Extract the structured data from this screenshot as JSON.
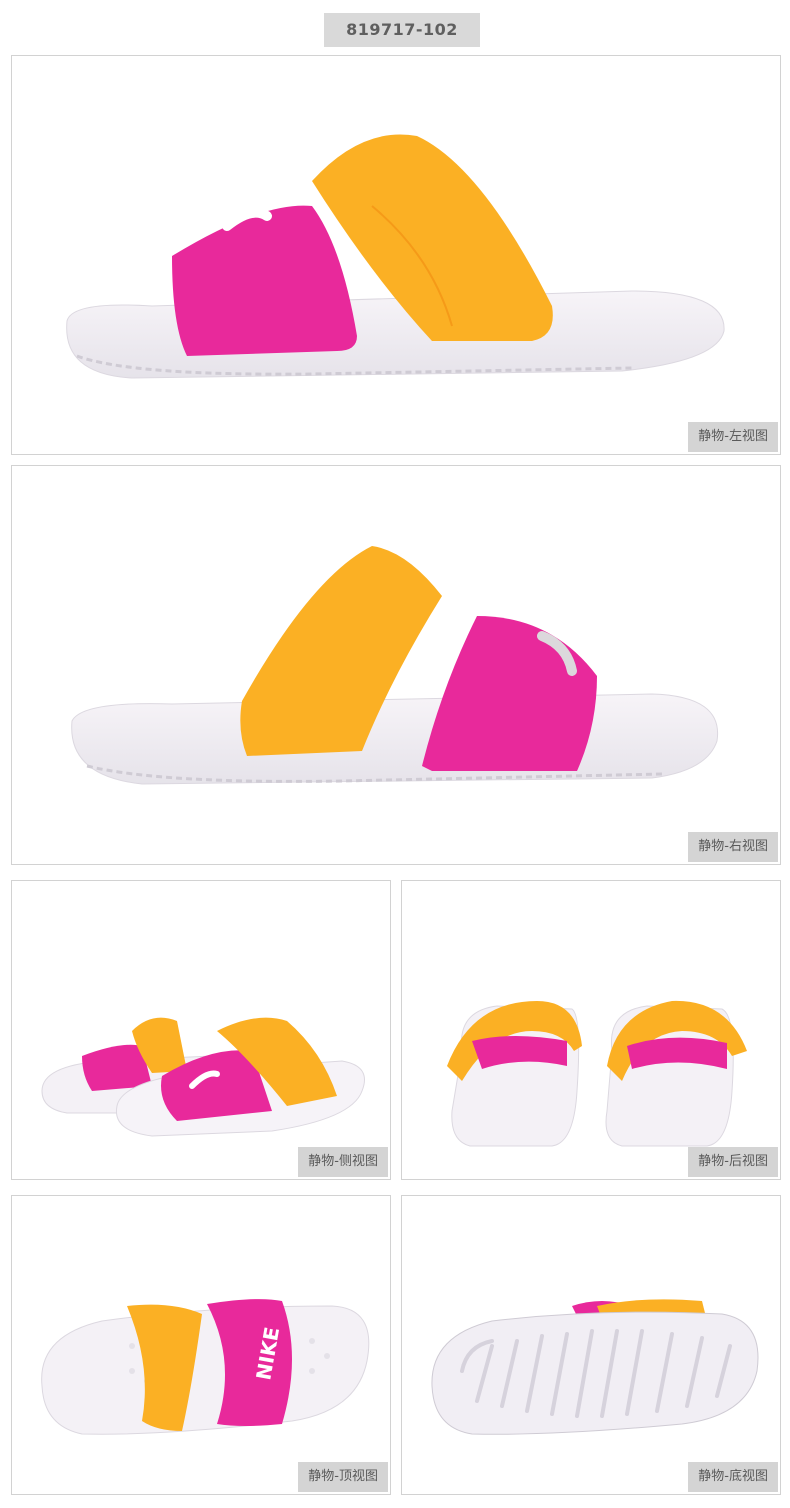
{
  "product": {
    "sku": "819717-102"
  },
  "colors": {
    "pink": "#e8299b",
    "yellow": "#fbb024",
    "sole": "#f3f1f5",
    "caption_bg": "#d4d4d4"
  },
  "views": [
    {
      "caption": "静物-左视图"
    },
    {
      "caption": "静物-右视图"
    },
    {
      "caption": "静物-侧视图"
    },
    {
      "caption": "静物-后视图"
    },
    {
      "caption": "静物-顶视图"
    },
    {
      "caption": "静物-底视图"
    }
  ],
  "brand_text": "NIKE"
}
